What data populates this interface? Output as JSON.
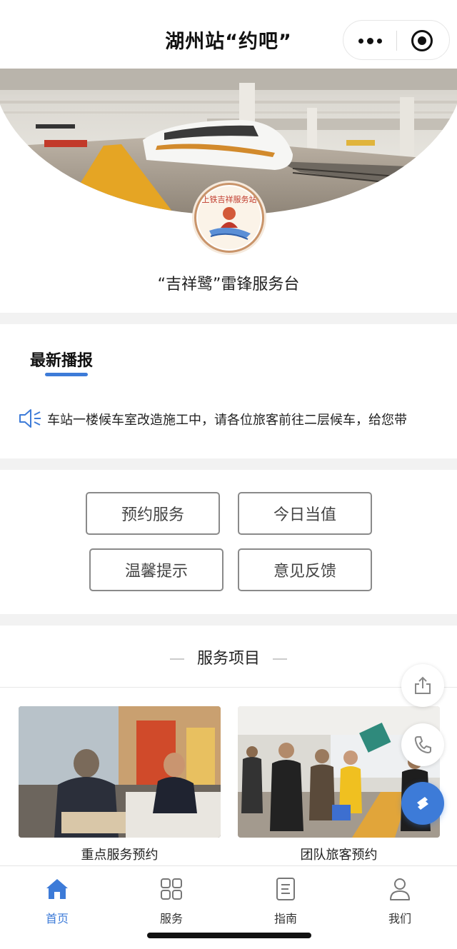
{
  "header": {
    "title": "湖州站“约吧”"
  },
  "hero": {
    "caption": "“吉祥鹭”雷锋服务台",
    "logo_text": "上铁吉祥服务站"
  },
  "news": {
    "title": "最新播报",
    "ticker": "车站一楼候车室改造施工中，请各位旅客前往二层候车，给您带"
  },
  "actions": {
    "items": [
      {
        "label": "预约服务"
      },
      {
        "label": "今日当值"
      },
      {
        "label": "温馨提示"
      },
      {
        "label": "意见反馈"
      }
    ]
  },
  "services": {
    "heading": "服务项目",
    "cards": [
      {
        "label": "重点服务预约"
      },
      {
        "label": "团队旅客预约"
      }
    ]
  },
  "tabbar": {
    "items": [
      {
        "label": "首页",
        "icon": "home-icon",
        "active": true
      },
      {
        "label": "服务",
        "icon": "grid-icon"
      },
      {
        "label": "指南",
        "icon": "guide-icon"
      },
      {
        "label": "我们",
        "icon": "user-icon"
      }
    ]
  },
  "colors": {
    "accent": "#3d7bd8",
    "logo_border": "#c9946a"
  }
}
